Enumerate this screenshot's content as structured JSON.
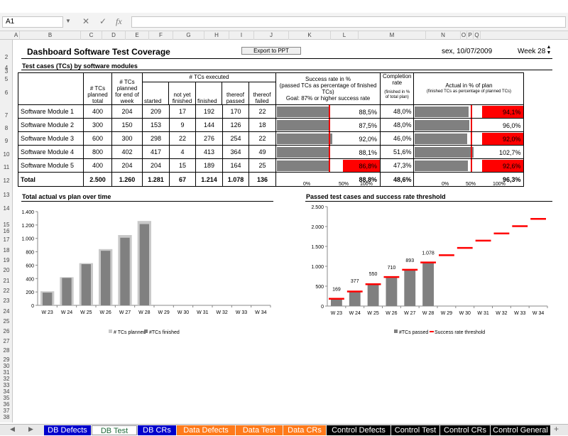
{
  "formula_bar": {
    "name_box": "A1",
    "fx": "fx",
    "cancel": "✕",
    "enter": "✓"
  },
  "columns": [
    "A",
    "B",
    "C",
    "D",
    "E",
    "F",
    "G",
    "H",
    "I",
    "J",
    "K",
    "L",
    "M",
    "N",
    "O",
    "P",
    "Q"
  ],
  "rows": [
    "2",
    "3",
    "4",
    "5",
    "6",
    "7",
    "8",
    "9",
    "10",
    "11",
    "12",
    "13",
    "14",
    "15",
    "16",
    "17",
    "18",
    "19",
    "20",
    "21",
    "22",
    "23",
    "24",
    "25",
    "26",
    "27",
    "28",
    "29",
    "30",
    "31",
    "32",
    "33",
    "34",
    "35",
    "36",
    "37",
    "38",
    "39",
    "40",
    "41",
    "42",
    "43",
    "44",
    "45",
    "46",
    "47",
    "48"
  ],
  "header": {
    "title": "Dashboard Software Test Coverage",
    "export_label": "Export to PPT",
    "date": "sex, 10/07/2009",
    "week": "Week 28"
  },
  "table": {
    "section_title": "Test cases (TCs) by software modules",
    "col_headers": {
      "planned": "# TCs planned total",
      "planned_eow": "# TCs planned for end of week",
      "executed_group": "# TCs executed",
      "started": "started",
      "not_finished": "not yet finished",
      "finished": "finished",
      "passed": "thereof passed",
      "failed": "thereof failed",
      "success_title": "Success rate in %",
      "success_sub": "(passed TCs as percentage of finished TCs)",
      "success_goal": "Goal: 87% or higher success rate",
      "completion_title": "Completion rate",
      "completion_sub": "(finished in % of total plan)",
      "actual_title": "Actual in % of plan",
      "actual_sub": "(finished TCs as percentage of planned TCs)"
    },
    "rows": [
      {
        "name": "Software Module 1",
        "planned": "400",
        "planned_eow": "204",
        "started": "209",
        "not_finished": "17",
        "finished": "192",
        "passed": "170",
        "failed": "22",
        "success": "88,5%",
        "completion": "48,0%",
        "actual": "94,1%",
        "success_v": 88.5,
        "actual_v": 94.1,
        "success_red": false,
        "actual_red": true
      },
      {
        "name": "Software Module 2",
        "planned": "300",
        "planned_eow": "150",
        "started": "153",
        "not_finished": "9",
        "finished": "144",
        "passed": "126",
        "failed": "18",
        "success": "87,5%",
        "completion": "48,0%",
        "actual": "96,0%",
        "success_v": 87.5,
        "actual_v": 96.0,
        "success_red": false,
        "actual_red": false
      },
      {
        "name": "Software Module 3",
        "planned": "600",
        "planned_eow": "300",
        "started": "298",
        "not_finished": "22",
        "finished": "276",
        "passed": "254",
        "failed": "22",
        "success": "92,0%",
        "completion": "46,0%",
        "actual": "92,0%",
        "success_v": 92.0,
        "actual_v": 92.0,
        "success_red": false,
        "actual_red": true
      },
      {
        "name": "Software Module 4",
        "planned": "800",
        "planned_eow": "402",
        "started": "417",
        "not_finished": "4",
        "finished": "413",
        "passed": "364",
        "failed": "49",
        "success": "88,1%",
        "completion": "51,6%",
        "actual": "102,7%",
        "success_v": 88.1,
        "actual_v": 102.7,
        "success_red": false,
        "actual_red": false
      },
      {
        "name": "Software Module 5",
        "planned": "400",
        "planned_eow": "204",
        "started": "204",
        "not_finished": "15",
        "finished": "189",
        "passed": "164",
        "failed": "25",
        "success": "86,8%",
        "completion": "47,3%",
        "actual": "92,6%",
        "success_v": 86.8,
        "actual_v": 92.6,
        "success_red": true,
        "actual_red": true
      }
    ],
    "total": {
      "name": "Total",
      "planned": "2.500",
      "planned_eow": "1.260",
      "started": "1.281",
      "not_finished": "67",
      "finished": "1.214",
      "passed": "1.078",
      "failed": "136",
      "success": "88,8%",
      "completion": "48,6%",
      "actual": "96,3%"
    },
    "scale_labels": {
      "zero": "0%",
      "fifty": "50%",
      "hundred": "100%"
    },
    "success_threshold": 87,
    "actual_threshold": 100
  },
  "chart_data": [
    {
      "type": "bar",
      "title": "Total actual vs plan over time",
      "categories": [
        "W 23",
        "W 24",
        "W 25",
        "W 26",
        "W 27",
        "W 28",
        "W 29",
        "W 30",
        "W 31",
        "W 32",
        "W 33",
        "W 34"
      ],
      "series": [
        {
          "name": "# TCs planned",
          "values": [
            210,
            420,
            630,
            840,
            1050,
            1260,
            null,
            null,
            null,
            null,
            null,
            null
          ],
          "color": "#c9c9c9"
        },
        {
          "name": "#TCs finished",
          "values": [
            190,
            410,
            615,
            815,
            1010,
            1214,
            null,
            null,
            null,
            null,
            null,
            null
          ],
          "color": "#808080"
        }
      ],
      "ylim": [
        0,
        1400
      ],
      "yticks": [
        "0",
        "200",
        "400",
        "600",
        "800",
        "1.000",
        "1.200",
        "1.400"
      ],
      "ytick_values": [
        0,
        200,
        400,
        600,
        800,
        1000,
        1200,
        1400
      ],
      "legend": "bottom"
    },
    {
      "type": "bar",
      "title": "Passed test cases and success rate threshold",
      "categories": [
        "W 23",
        "W 24",
        "W 25",
        "W 26",
        "W 27",
        "W 28",
        "W 29",
        "W 30",
        "W 31",
        "W 32",
        "W 33",
        "W 34"
      ],
      "series": [
        {
          "name": "#TCs passed",
          "values": [
            169,
            377,
            550,
            710,
            893,
            1078,
            null,
            null,
            null,
            null,
            null,
            null
          ],
          "labels": [
            "169",
            "377",
            "550",
            "710",
            "893",
            "1.078"
          ],
          "color": "#808080"
        },
        {
          "name": "Success rate threshold",
          "values": [
            183,
            366,
            548,
            731,
            914,
            1096,
            1279,
            1462,
            1644,
            1827,
            2010,
            2192
          ],
          "color": "#ff0000"
        }
      ],
      "ylim": [
        0,
        2500
      ],
      "yticks": [
        "0",
        "500",
        "1.000",
        "1.500",
        "2.000",
        "2.500"
      ],
      "ytick_values": [
        0,
        500,
        1000,
        1500,
        2000,
        2500
      ],
      "legend": "bottom"
    }
  ],
  "tabs": [
    {
      "label": "DB Defects",
      "bg": "#0000cc",
      "fg": "#ffffff"
    },
    {
      "label": "DB Test",
      "bg": "#ffffff",
      "fg": "#1f6b3a"
    },
    {
      "label": "DB CRs",
      "bg": "#0000cc",
      "fg": "#ffffff"
    },
    {
      "label": "Data Defects",
      "bg": "#ff7a1a",
      "fg": "#ffffff"
    },
    {
      "label": "Data Test",
      "bg": "#ff7a1a",
      "fg": "#ffffff"
    },
    {
      "label": "Data CRs",
      "bg": "#ff7a1a",
      "fg": "#ffffff"
    },
    {
      "label": "Control Defects",
      "bg": "#000000",
      "fg": "#ffffff"
    },
    {
      "label": "Control Test",
      "bg": "#000000",
      "fg": "#ffffff"
    },
    {
      "label": "Control CRs",
      "bg": "#000000",
      "fg": "#ffffff"
    },
    {
      "label": "Control General",
      "bg": "#000000",
      "fg": "#ffffff"
    }
  ],
  "tab_add": "+"
}
